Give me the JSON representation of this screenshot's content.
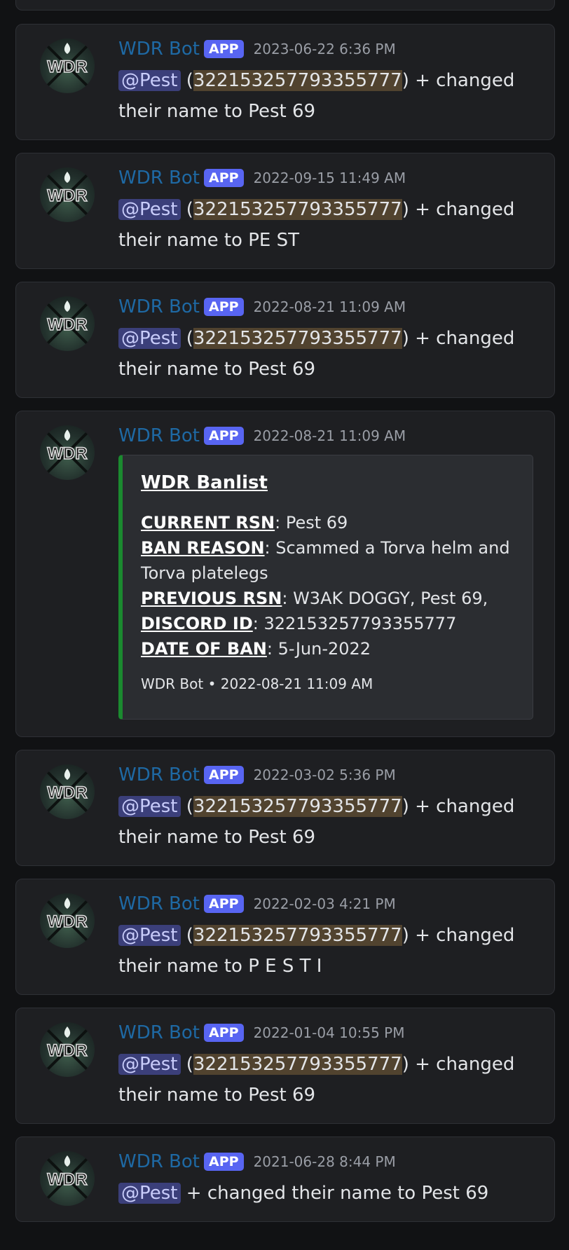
{
  "bot": {
    "name": "WDR Bot",
    "badge": "APP"
  },
  "messages": [
    {
      "timestamp": "2023-06-22 6:36 PM",
      "mention": "@Pest",
      "id": "322153257793355777",
      "text": ") + changed their name to Pest 69",
      "open": " ("
    },
    {
      "timestamp": "2022-09-15 11:49 AM",
      "mention": "@Pest",
      "id": "322153257793355777",
      "text": ") + changed their name to PE ST",
      "open": " ("
    },
    {
      "timestamp": "2022-08-21 11:09 AM",
      "mention": "@Pest",
      "id": "322153257793355777",
      "text": ") + changed their name to Pest 69",
      "open": " ("
    },
    {
      "timestamp": "2022-08-21 11:09 AM"
    },
    {
      "timestamp": "2022-03-02 5:36 PM",
      "mention": "@Pest",
      "id": "322153257793355777",
      "text": ") + changed their name to Pest 69",
      "open": " ("
    },
    {
      "timestamp": "2022-02-03 4:21 PM",
      "mention": "@Pest",
      "id": "322153257793355777",
      "text": ") + changed their name to P E S T I",
      "open": " ("
    },
    {
      "timestamp": "2022-01-04 10:55 PM",
      "mention": "@Pest",
      "id": "322153257793355777",
      "text": ") + changed their name to Pest 69",
      "open": " ("
    },
    {
      "timestamp": "2021-06-28 8:44 PM",
      "mention": "@Pest",
      "text": " + changed their name to Pest 69"
    }
  ],
  "embed": {
    "title": "WDR Banlist",
    "fields": [
      {
        "label": "CURRENT RSN",
        "value": ": Pest 69"
      },
      {
        "label": "BAN REASON",
        "value": ": Scammed a Torva helm and Torva platelegs"
      },
      {
        "label": "PREVIOUS RSN",
        "value": ": W3AK DOGGY, Pest 69,"
      },
      {
        "label": "DISCORD ID",
        "value": ": 322153257793355777"
      },
      {
        "label": "DATE OF BAN",
        "value": ": 5-Jun-2022"
      }
    ],
    "footer": "WDR Bot • 2022-08-21 11:09 AM",
    "color": "#1b8a2f"
  },
  "colors": {
    "username": "#1e69a4",
    "badge": "#5865f2",
    "mention_bg": "#3b3f7a",
    "id_highlight": "#51432f"
  },
  "icons": {
    "avatar": "wdr-avatar-icon"
  }
}
